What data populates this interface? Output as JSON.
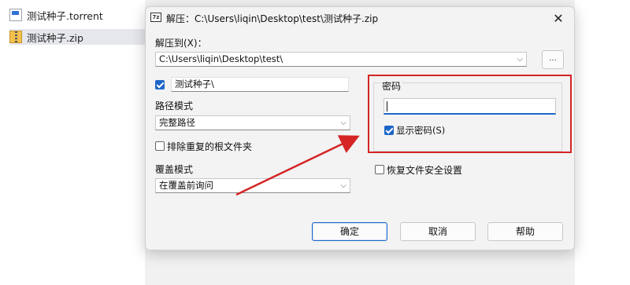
{
  "explorer": {
    "files": [
      {
        "name": "测试种子.torrent",
        "icon": "torrent-file-icon"
      },
      {
        "name": "测试种子.zip",
        "icon": "zip-file-icon"
      }
    ]
  },
  "dialog": {
    "title": "解压：C:\\Users\\liqin\\Desktop\\test\\测试种子.zip",
    "extract_to_label": "解压到(X)：",
    "extract_to_value": "C:\\Users\\liqin\\Desktop\\test\\",
    "browse_label": "...",
    "subfolder_value": "测试种子\\",
    "path_mode_label": "路径模式",
    "path_mode_value": "完整路径",
    "exclude_root_label": "排除重复的根文件夹",
    "overwrite_mode_label": "覆盖模式",
    "overwrite_mode_value": "在覆盖前询问",
    "password_group_label": "密码",
    "password_value": "",
    "show_password_label": "显示密码(S)",
    "restore_security_label": "恢复文件安全设置",
    "buttons": {
      "ok": "确定",
      "cancel": "取消",
      "help": "帮助"
    }
  },
  "colors": {
    "accent": "#1d66c7",
    "annotation": "#d42424"
  }
}
